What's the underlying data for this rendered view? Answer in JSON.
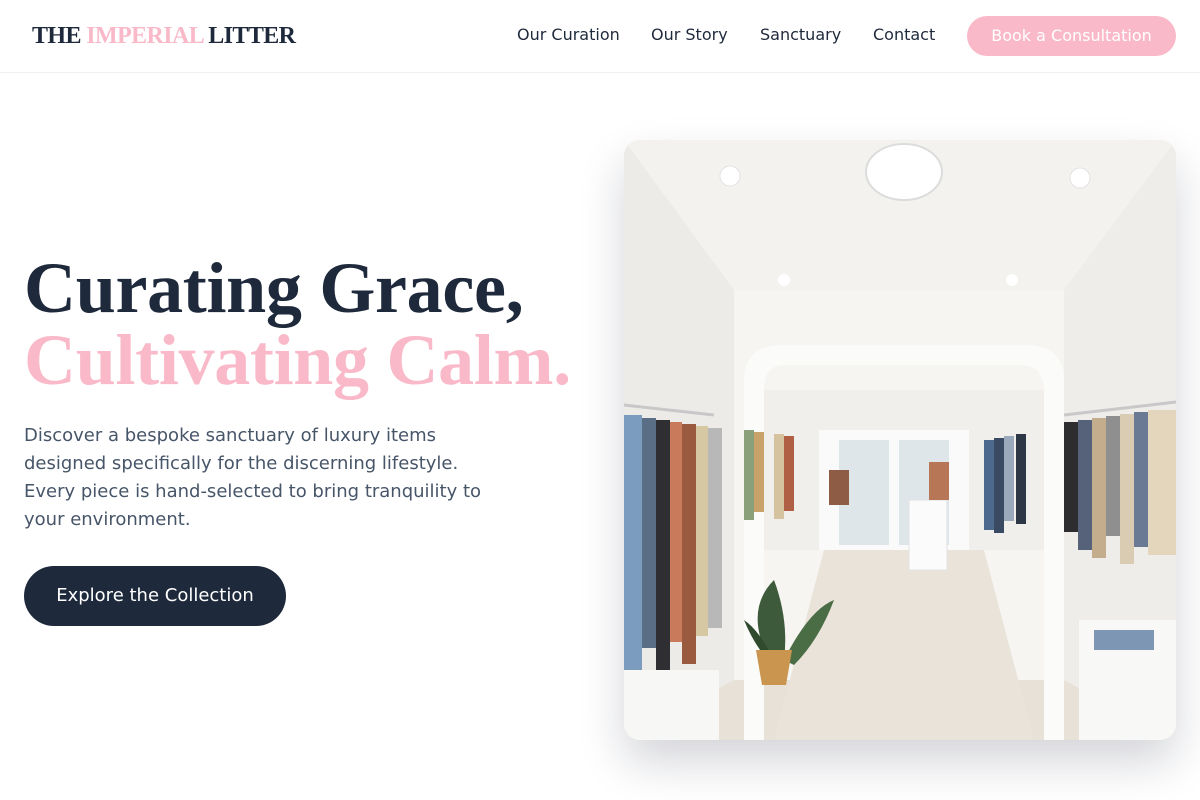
{
  "brand": {
    "part1": "THE",
    "part2": "IMPERIAL",
    "part3": "LITTER"
  },
  "nav": {
    "items": [
      {
        "label": "Our Curation"
      },
      {
        "label": "Our Story"
      },
      {
        "label": "Sanctuary"
      },
      {
        "label": "Contact"
      }
    ],
    "cta_label": "Book a Consultation"
  },
  "hero": {
    "title_line1": "Curating Grace,",
    "title_line2": "Cultivating Calm.",
    "description": "Discover a bespoke sanctuary of luxury items designed specifically for the discerning lifestyle. Every piece is hand-selected to bring tranquility to your environment.",
    "button_label": "Explore the Collection"
  },
  "colors": {
    "navy": "#1e293b",
    "pink": "#f9b9c9",
    "body_text": "#475569"
  }
}
